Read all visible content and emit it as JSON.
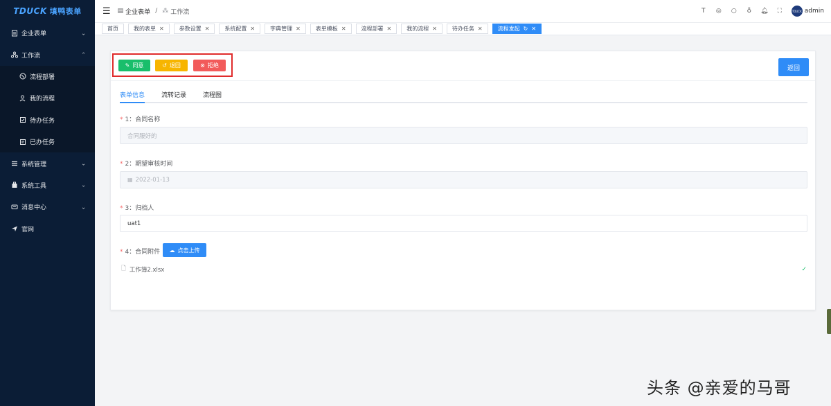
{
  "app": {
    "logo_main": "TDUCK",
    "logo_sub": "填鸭表单"
  },
  "sidebar": {
    "items": [
      {
        "label": "企业表单",
        "icon": "form-icon",
        "expanded": false
      },
      {
        "label": "工作流",
        "icon": "workflow-icon",
        "expanded": true
      },
      {
        "label": "系统管理",
        "icon": "system-icon",
        "expanded": false
      },
      {
        "label": "系统工具",
        "icon": "tools-icon",
        "expanded": false
      },
      {
        "label": "消息中心",
        "icon": "message-icon",
        "expanded": false
      },
      {
        "label": "官网",
        "icon": "send-icon",
        "expanded": false
      }
    ],
    "workflow_sub": [
      {
        "label": "流程部署",
        "icon": "deploy-icon"
      },
      {
        "label": "我的流程",
        "icon": "user-flow-icon"
      },
      {
        "label": "待办任务",
        "icon": "todo-icon"
      },
      {
        "label": "已办任务",
        "icon": "done-icon"
      }
    ]
  },
  "header": {
    "breadcrumb": [
      "企业表单",
      "/",
      "工作流"
    ],
    "user": "admin",
    "avatar_text": "TDUCK"
  },
  "tabs": [
    {
      "label": "首页",
      "closable": false,
      "active": false
    },
    {
      "label": "我的表单",
      "closable": true,
      "active": false
    },
    {
      "label": "参数设置",
      "closable": true,
      "active": false
    },
    {
      "label": "系统配置",
      "closable": true,
      "active": false
    },
    {
      "label": "字典管理",
      "closable": true,
      "active": false
    },
    {
      "label": "表单模板",
      "closable": true,
      "active": false
    },
    {
      "label": "流程部署",
      "closable": true,
      "active": false
    },
    {
      "label": "我的流程",
      "closable": true,
      "active": false
    },
    {
      "label": "待办任务",
      "closable": true,
      "active": false
    },
    {
      "label": "流程发起",
      "closable": true,
      "active": true
    }
  ],
  "actions": {
    "agree": "同意",
    "back": "退回",
    "reject": "拒绝",
    "return": "返回"
  },
  "inner_tabs": [
    "表单信息",
    "流转记录",
    "流程图"
  ],
  "form": {
    "field1": {
      "label": "1：合同名称",
      "value": "合同服好的"
    },
    "field2": {
      "label": "2：期望审核时间",
      "value": "2022-01-13"
    },
    "field3": {
      "label": "3：归档人",
      "value": "uat1"
    },
    "field4": {
      "label": "4：合同附件",
      "button": "点击上传",
      "file": "工作簿2.xlsx"
    }
  },
  "watermark": "头条 @亲爱的马哥",
  "colors": {
    "primary": "#2f8cf7",
    "success": "#19be6b",
    "warning": "#f7b500",
    "danger": "#f25b5b",
    "sidebar": "#0b1d36"
  }
}
